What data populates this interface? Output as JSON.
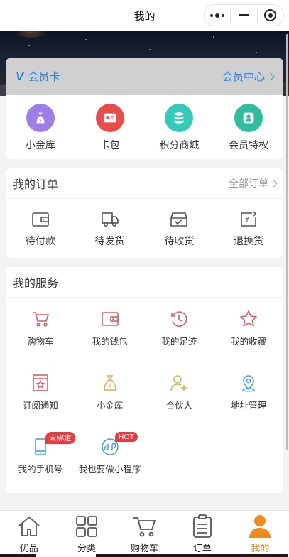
{
  "topbar": {
    "title": "我的"
  },
  "vip": {
    "logo": "V",
    "title": "会员卡",
    "center_label": "会员中心",
    "items": [
      {
        "label": "小金库",
        "icon": "money-bag-icon",
        "color": "#9d7ee6"
      },
      {
        "label": "卡包",
        "icon": "card-icon",
        "color": "#ea4b4b"
      },
      {
        "label": "积分商城",
        "icon": "database-icon",
        "color": "#37c9b8"
      },
      {
        "label": "会员特权",
        "icon": "user-badge-icon",
        "color": "#2fbc9f"
      }
    ]
  },
  "orders": {
    "title": "我的订单",
    "more_label": "全部订单",
    "items": [
      {
        "label": "待付款",
        "icon": "wallet-icon"
      },
      {
        "label": "待发货",
        "icon": "truck-icon"
      },
      {
        "label": "待收货",
        "icon": "box-icon"
      },
      {
        "label": "退换货",
        "icon": "refund-icon"
      }
    ]
  },
  "services": {
    "title": "我的服务",
    "items": [
      {
        "label": "购物车",
        "icon": "cart-icon",
        "color": "#e8595a"
      },
      {
        "label": "我的钱包",
        "icon": "wallet-icon",
        "color": "#e8595a"
      },
      {
        "label": "我的足迹",
        "icon": "history-icon",
        "color": "#e8595a"
      },
      {
        "label": "我的收藏",
        "icon": "star-icon",
        "color": "#e8595a"
      },
      {
        "label": "订阅通知",
        "icon": "subscribe-icon",
        "color": "#e8595a"
      },
      {
        "label": "小金库",
        "icon": "money-bag-icon",
        "color": "#e9a94a"
      },
      {
        "label": "合伙人",
        "icon": "partner-icon",
        "color": "#e9a94a"
      },
      {
        "label": "地址管理",
        "icon": "location-icon",
        "color": "#3d9fe0"
      },
      {
        "label": "我的手机号",
        "icon": "phone-icon",
        "color": "#3d9fe0",
        "badge": "未绑定"
      },
      {
        "label": "我也要做小程序",
        "icon": "miniprogram-icon",
        "color": "#3d9fe0",
        "badge": "HOT"
      }
    ]
  },
  "tabbar": {
    "items": [
      {
        "label": "优品",
        "icon": "home-icon"
      },
      {
        "label": "分类",
        "icon": "grid-icon"
      },
      {
        "label": "购物车",
        "icon": "cart-icon"
      },
      {
        "label": "订单",
        "icon": "clipboard-icon"
      },
      {
        "label": "我的",
        "icon": "user-icon",
        "active": true,
        "color": "#f08a1a"
      }
    ]
  }
}
